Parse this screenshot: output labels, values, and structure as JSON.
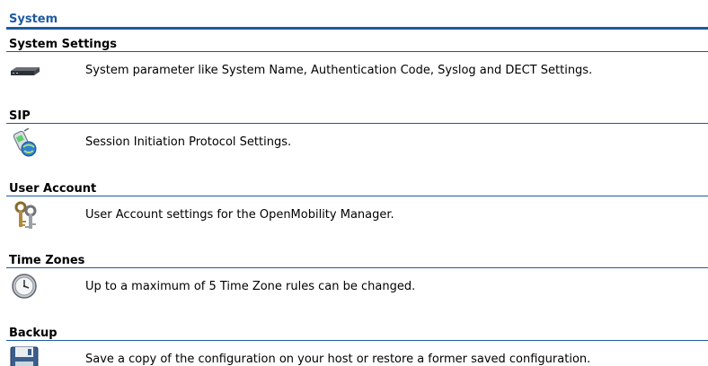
{
  "page": {
    "title": "System"
  },
  "sections": [
    {
      "title": "System Settings",
      "description": "System parameter like System Name, Authentication Code, Syslog and DECT Settings.",
      "icon": "device-icon"
    },
    {
      "title": "SIP",
      "description": "Session Initiation Protocol Settings.",
      "icon": "sip-phone-icon"
    },
    {
      "title": "User Account",
      "description": "User Account settings for the OpenMobility Manager.",
      "icon": "keys-icon"
    },
    {
      "title": "Time Zones",
      "description": "Up to a maximum of 5 Time Zone rules can be changed.",
      "icon": "clock-icon"
    },
    {
      "title": "Backup",
      "description": "Save a copy of the configuration on your host or restore a former saved configuration.",
      "icon": "floppy-disk-icon"
    }
  ],
  "colors": {
    "accent": "#1e5aa0",
    "text": "#000000",
    "background": "#ffffff"
  }
}
